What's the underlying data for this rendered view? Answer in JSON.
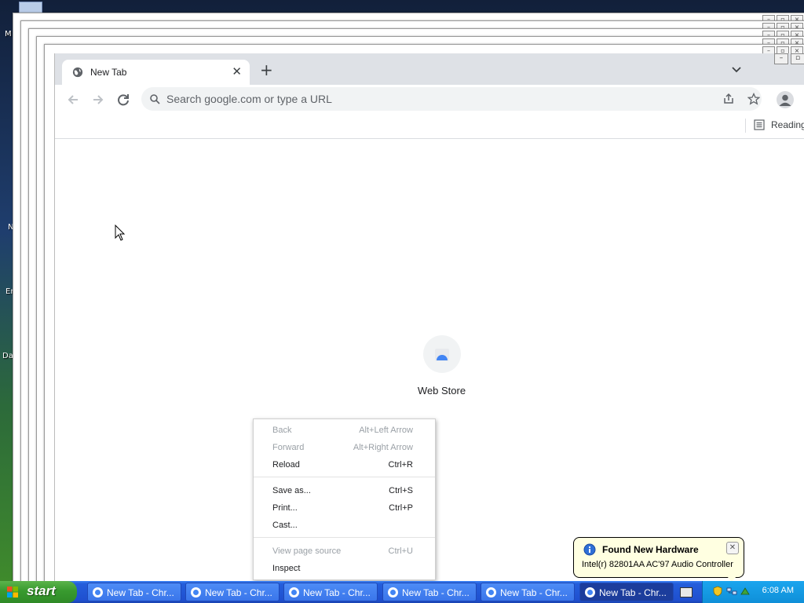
{
  "desktop": {
    "icon_labels": [
      "M",
      "N",
      "Er",
      "Da"
    ]
  },
  "browser": {
    "tab": {
      "title": "New Tab"
    },
    "omnibox": {
      "placeholder": "Search google.com or type a URL",
      "value": ""
    },
    "bookmarks": {
      "reading_list": "Reading"
    },
    "shortcut": {
      "label": "Web Store"
    }
  },
  "context_menu": {
    "items": [
      {
        "label": "Back",
        "shortcut": "Alt+Left Arrow",
        "enabled": false
      },
      {
        "label": "Forward",
        "shortcut": "Alt+Right Arrow",
        "enabled": false
      },
      {
        "label": "Reload",
        "shortcut": "Ctrl+R",
        "enabled": true
      },
      {
        "label": "Save as...",
        "shortcut": "Ctrl+S",
        "enabled": true
      },
      {
        "label": "Print...",
        "shortcut": "Ctrl+P",
        "enabled": true
      },
      {
        "label": "Cast...",
        "shortcut": "",
        "enabled": true
      },
      {
        "label": "View page source",
        "shortcut": "Ctrl+U",
        "enabled": false
      },
      {
        "label": "Inspect",
        "shortcut": "",
        "enabled": true
      }
    ]
  },
  "taskbar": {
    "start_label": "start",
    "buttons": [
      {
        "label": "New Tab - Chr..."
      },
      {
        "label": "New Tab - Chr..."
      },
      {
        "label": "New Tab - Chr..."
      },
      {
        "label": "New Tab - Chr..."
      },
      {
        "label": "New Tab - Chr..."
      },
      {
        "label": "New Tab - Chr..."
      }
    ],
    "clock": "6:08 AM"
  },
  "notification": {
    "title": "Found New Hardware",
    "message": "Intel(r) 82801AA AC'97 Audio Controller"
  },
  "colors": {
    "accent_blue": "#4285f4",
    "taskbar": "#245edb",
    "start_green": "#389a2f",
    "balloon_bg": "#ffffe1"
  }
}
